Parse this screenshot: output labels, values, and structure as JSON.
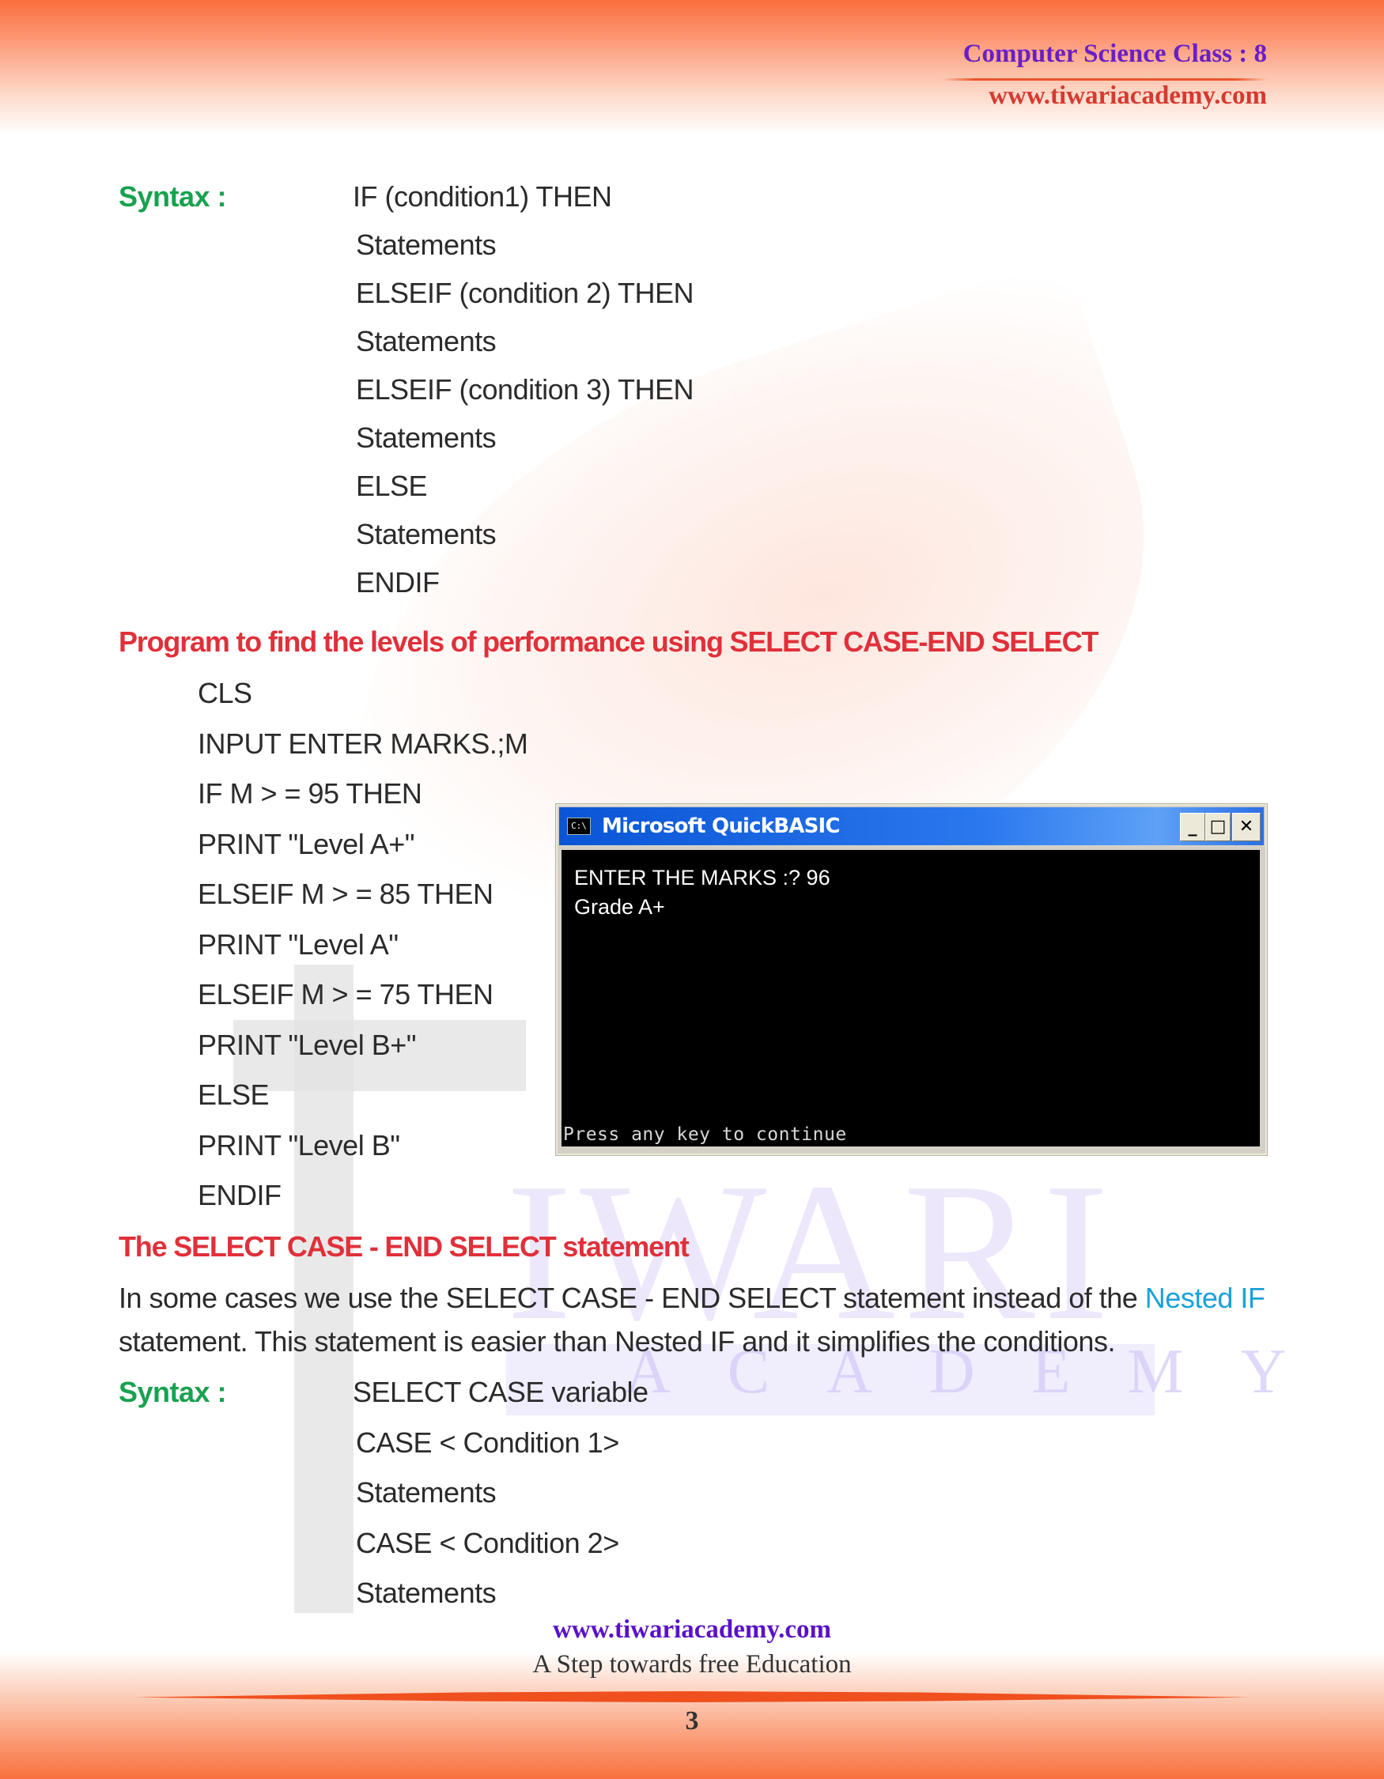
{
  "header": {
    "title": "Computer Science Class : 8",
    "url": "www.tiwariacademy.com"
  },
  "watermark": {
    "word": "IWARI",
    "subword": "ACADEMY"
  },
  "section1": {
    "syntax_label": "Syntax :",
    "lines": [
      "IF (condition1) THEN",
      "Statements",
      "ELSEIF (condition 2) THEN",
      "Statements",
      "ELSEIF (condition 3) THEN",
      "Statements",
      "ELSE",
      "Statements",
      "ENDIF"
    ]
  },
  "program": {
    "heading": "Program to find the levels of performance using SELECT CASE-END SELECT",
    "lines": [
      "CLS",
      "INPUT ENTER MARKS.;M",
      "IF M > = 95 THEN",
      "PRINT \"Level A+\"",
      "ELSEIF M > = 85 THEN",
      "PRINT \"Level A\"",
      "ELSEIF M > = 75 THEN",
      "PRINT \"Level B+\"",
      "ELSE",
      "PRINT \"Level B\"",
      "ENDIF"
    ]
  },
  "qb_window": {
    "icon_text": "C:\\",
    "title": "Microsoft QuickBASIC",
    "minimize": "_",
    "maximize": "□",
    "close": "✕",
    "output": [
      "ENTER THE MARKS :? 96",
      "Grade A+"
    ],
    "prompt": "Press any key to continue"
  },
  "section2": {
    "heading": "The SELECT CASE - END SELECT statement",
    "para_line1_pre": "In some cases we use the SELECT CASE - END SELECT statement instead of the ",
    "para_link": "Nested IF",
    "para_line2": "statement. This statement is easier than Nested IF and it simplifies the conditions.",
    "syntax_label": "Syntax :",
    "lines": [
      "SELECT CASE variable",
      "CASE < Condition 1>",
      "Statements",
      "CASE < Condition 2>",
      "Statements"
    ]
  },
  "footer": {
    "url": "www.tiwariacademy.com",
    "tagline": "A Step towards free Education",
    "page_number": "3"
  }
}
